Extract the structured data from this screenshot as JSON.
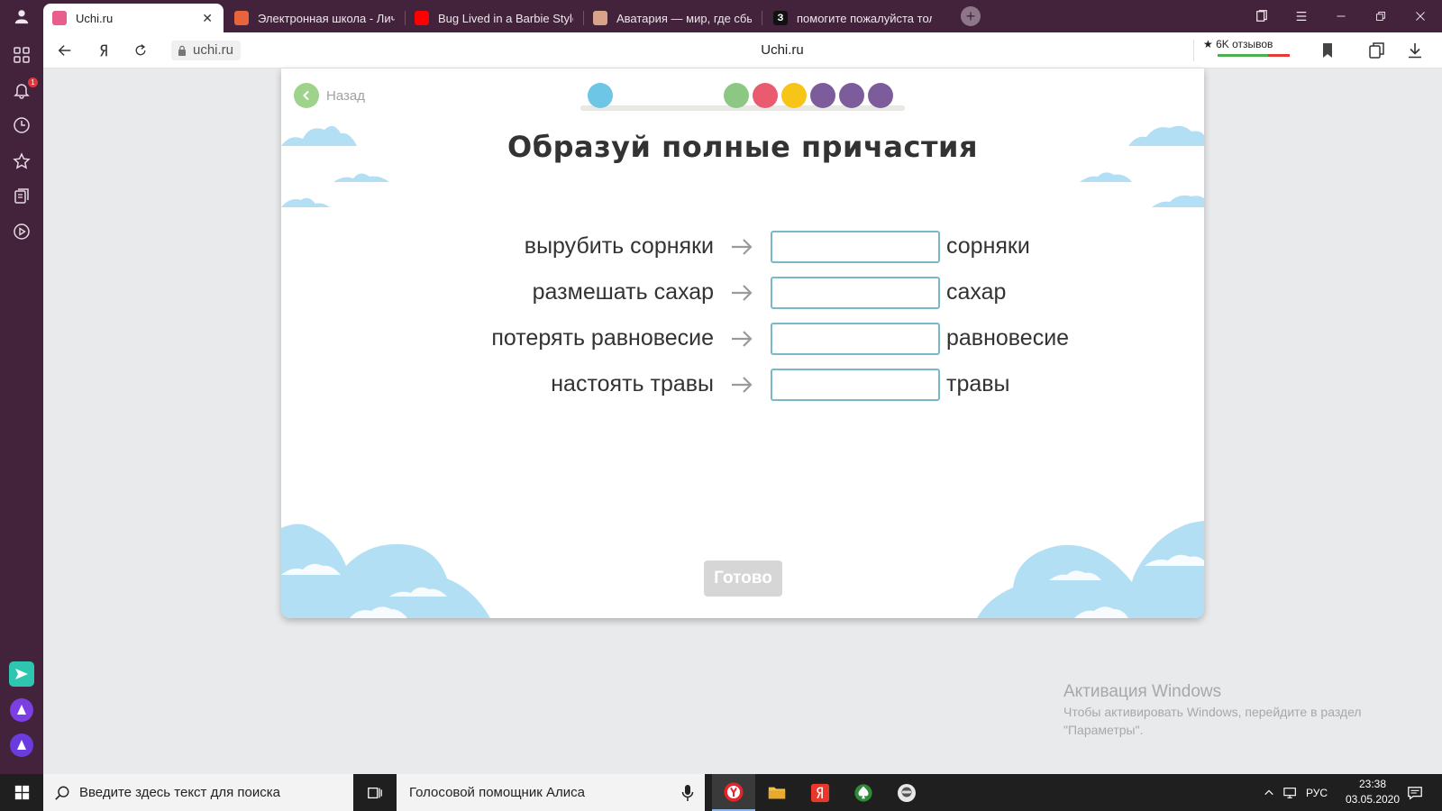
{
  "browser": {
    "tabs": [
      {
        "label": "Uchi.ru",
        "active": true,
        "fav_color": "#e85d8a"
      },
      {
        "label": "Электронная школа - Лич",
        "active": false,
        "fav_color": "#e8643c"
      },
      {
        "label": "Bug Lived in a Barbie Style",
        "active": false,
        "fav_color": "#ff0000"
      },
      {
        "label": "Аватария — мир, где сбы",
        "active": false,
        "fav_color": "#d9a38a"
      },
      {
        "label": "помогите пожалуйста тол",
        "active": false,
        "fav_color": "#111111",
        "fav_text": "З"
      }
    ],
    "close_glyph": "✕",
    "new_tab_glyph": "+",
    "url": "uchi.ru",
    "page_title": "Uchi.ru",
    "reviews": "★ 6K отзывов",
    "notification_count": "1"
  },
  "lesson": {
    "back_label": "Назад",
    "title": "Образуй полные причастия",
    "progress_dots": [
      "#6ec6e6",
      "#8cc784",
      "#ea5b6f",
      "#f7c518",
      "#7d5c9c",
      "#7d5c9c",
      "#7d5c9c"
    ],
    "rows": [
      {
        "phrase": "вырубить сорняки",
        "noun": "сорняки",
        "answer": ""
      },
      {
        "phrase": "размешать сахар",
        "noun": "сахар",
        "answer": ""
      },
      {
        "phrase": "потерять равновесие",
        "noun": "равновесие",
        "answer": ""
      },
      {
        "phrase": "настоять травы",
        "noun": "травы",
        "answer": ""
      }
    ],
    "done_label": "Готово"
  },
  "watermark": {
    "title": "Активация Windows",
    "line1": "Чтобы активировать Windows, перейдите в раздел",
    "line2": "\"Параметры\"."
  },
  "taskbar": {
    "search_placeholder": "Введите здесь текст для поиска",
    "alice_label": "Голосовой помощник Алиса",
    "language": "РУС",
    "time": "23:38",
    "date": "03.05.2020"
  }
}
